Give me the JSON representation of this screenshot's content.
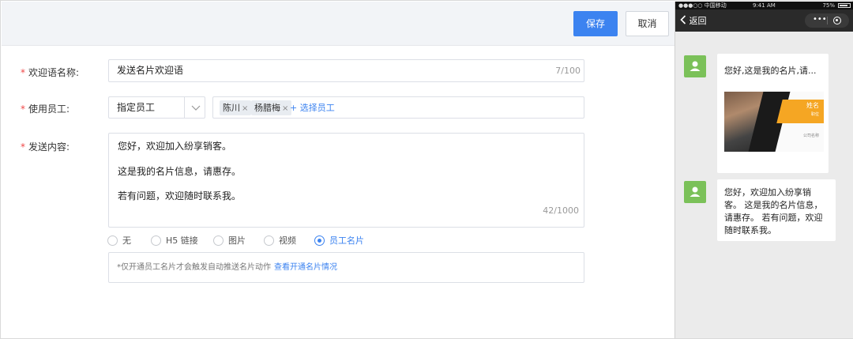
{
  "toolbar": {
    "save_label": "保存",
    "cancel_label": "取消"
  },
  "form": {
    "welcome_name": {
      "label": "欢迎语名称:",
      "value": "发送名片欢迎语",
      "count": "7/100"
    },
    "staff": {
      "label": "使用员工:",
      "select_value": "指定员工",
      "tags": [
        "陈川",
        "杨腊梅"
      ],
      "tag_remove": "×",
      "add_label": "+ 选择员工"
    },
    "content": {
      "label": "发送内容:",
      "lines": [
        "您好，欢迎加入纷享销客。",
        "这是我的名片信息，请惠存。",
        "若有问题，欢迎随时联系我。"
      ],
      "count": "42/1000"
    },
    "attachment_options": [
      "无",
      "H5 链接",
      "图片",
      "视频",
      "员工名片"
    ],
    "selected_option": "员工名片",
    "notice": {
      "text": "*仅开通员工名片才会触发自动推送名片动作",
      "link": "查看开通名片情况"
    }
  },
  "preview": {
    "status": {
      "carrier": "●●●○○ 中国移动",
      "time": "9:41 AM",
      "battery": "75%"
    },
    "nav": {
      "back_label": "返回",
      "dots": "•••"
    },
    "card": {
      "title": "您好,这是我的名片,请...",
      "name": "姓名",
      "position": "职位",
      "company": "公司名称"
    },
    "message_lines": [
      "您好，欢迎加入纷享销",
      "客。 这是我的名片信息，",
      "请惠存。 若有问题，欢迎",
      "随时联系我。"
    ],
    "colors": {
      "avatar": "#7bc159",
      "accent": "#3c83f0",
      "card_orange": "#f5a623"
    }
  }
}
